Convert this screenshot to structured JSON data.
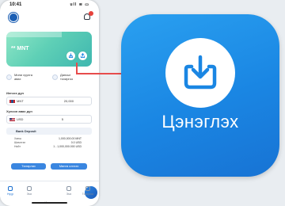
{
  "status": {
    "time": "10:41",
    "icons": "ull ≋ ▭"
  },
  "card": {
    "balance": "** MNT",
    "accent": "#5fd0b6"
  },
  "quick_actions": [
    {
      "label": "Мини хуулга\nавах"
    },
    {
      "label": "Дансыг\nтохиргоо"
    }
  ],
  "form": {
    "amount_label": "Илгээх дүн",
    "currency_1": "MNT",
    "amount_1": "20,000",
    "receive_label": "Хүлээн авах дүн",
    "currency_2": "USD",
    "amount_2": "5",
    "method": "Bank Deposit",
    "info": [
      {
        "label": "Ханш",
        "value": "1,000,000.00 MNT"
      },
      {
        "label": "Шимтгэл",
        "value": "0.0 USD"
      },
      {
        "label": "Нийт",
        "value": "1 - 1,000,000.000 USD"
      }
    ],
    "button_left": "Төлөрлөх",
    "button_right": "Мөнгө илгээх",
    "button_color": "#3a86e0"
  },
  "tabs": [
    {
      "label": "Нүүр"
    },
    {
      "label": "Эмх"
    },
    {
      "label": "Илгээх"
    },
    {
      "label": "Эмх"
    },
    {
      "label": "Тохиргоо"
    }
  ],
  "app_icon": {
    "label": "Цэнэглэх",
    "icon": "download-tray-icon",
    "background": "#1a86e3"
  },
  "connector_color": "#e74c4c"
}
